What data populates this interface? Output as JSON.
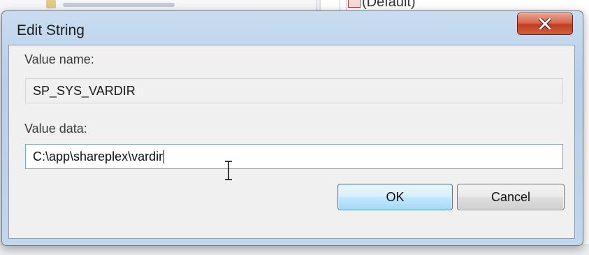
{
  "background": {
    "default_value_text": "(Default)"
  },
  "dialog": {
    "title": "Edit String",
    "close_label": "X",
    "value_name_label": "Value name:",
    "value_name": "SP_SYS_VARDIR",
    "value_data_label": "Value data:",
    "value_data": "C:\\app\\shareplex\\vardir",
    "ok_label": "OK",
    "cancel_label": "Cancel"
  },
  "colors": {
    "dialog_frame": "#c2d6ec",
    "close_button": "#c13e22",
    "ok_button": "#bee6fd",
    "focus_border": "#7da2ce"
  },
  "icons": {
    "close": "close-x-icon",
    "cursor": "text-cursor-ibeam-icon",
    "registry_value": "registry-string-value-icon"
  }
}
